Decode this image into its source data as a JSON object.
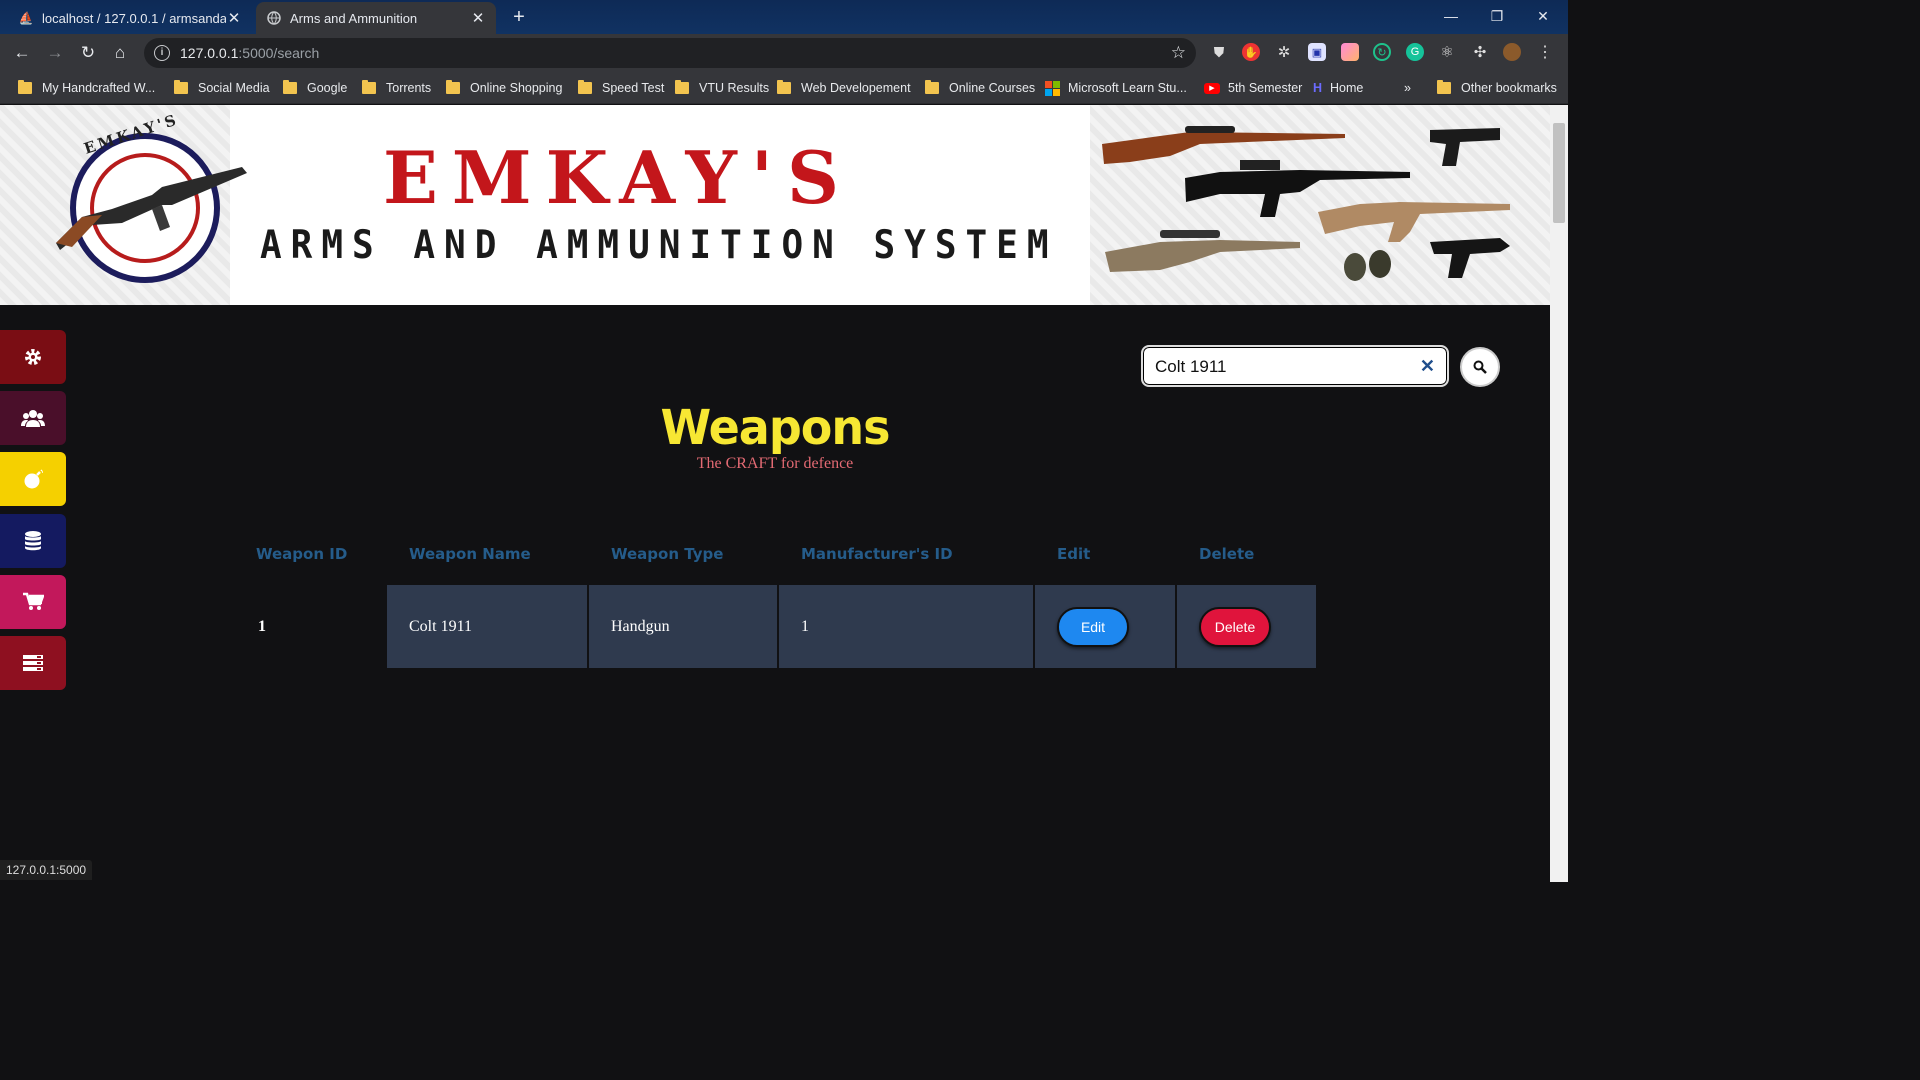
{
  "browser": {
    "tabs": [
      {
        "label": "localhost / 127.0.0.1 / armsandammunition"
      },
      {
        "label": "Arms and Ammunition"
      }
    ],
    "url_host": "127.0.0.1",
    "url_path": ":5000/search",
    "bookmarks": [
      "My Handcrafted W...",
      "Social Media",
      "Google",
      "Torrents",
      "Online Shopping",
      "Speed Test",
      "VTU Results",
      "Web Developement",
      "Online Courses",
      "Microsoft Learn Stu...",
      "5th Semester",
      "Home",
      "Other bookmarks"
    ],
    "status_url": "127.0.0.1:5000"
  },
  "banner": {
    "brand": "EMKAY'S",
    "subtitle": "ARMS AND AMMUNITION SYSTEM",
    "logo_text": "EMKAY'S"
  },
  "sidebar": {
    "items": [
      {
        "icon": "gear-icon",
        "color": "#7a0d14"
      },
      {
        "icon": "users-icon",
        "color": "#4a0f2a"
      },
      {
        "icon": "bomb-icon",
        "color": "#f5d000"
      },
      {
        "icon": "database-icon",
        "color": "#141a60"
      },
      {
        "icon": "cart-icon",
        "color": "#c2185b"
      },
      {
        "icon": "server-icon",
        "color": "#8e1020"
      }
    ]
  },
  "search": {
    "value": "Colt 1911",
    "clear_icon": "close-icon",
    "button_icon": "search-icon"
  },
  "page": {
    "title": "Weapons",
    "subtitle": "The CRAFT for defence"
  },
  "table": {
    "columns": [
      "Weapon ID",
      "Weapon Name",
      "Weapon Type",
      "Manufacturer's ID",
      "Edit",
      "Delete"
    ],
    "rows": [
      {
        "id": "1",
        "name": "Colt 1911",
        "type": "Handgun",
        "manufacturer_id": "1",
        "edit_label": "Edit",
        "delete_label": "Delete"
      }
    ]
  },
  "colors": {
    "heading": "#f7e733",
    "subheading": "#e36a73",
    "column_header": "#255c8a",
    "row_bg": "#2f3a4e",
    "edit_button": "#1e88f0",
    "delete_button": "#e0143c"
  }
}
